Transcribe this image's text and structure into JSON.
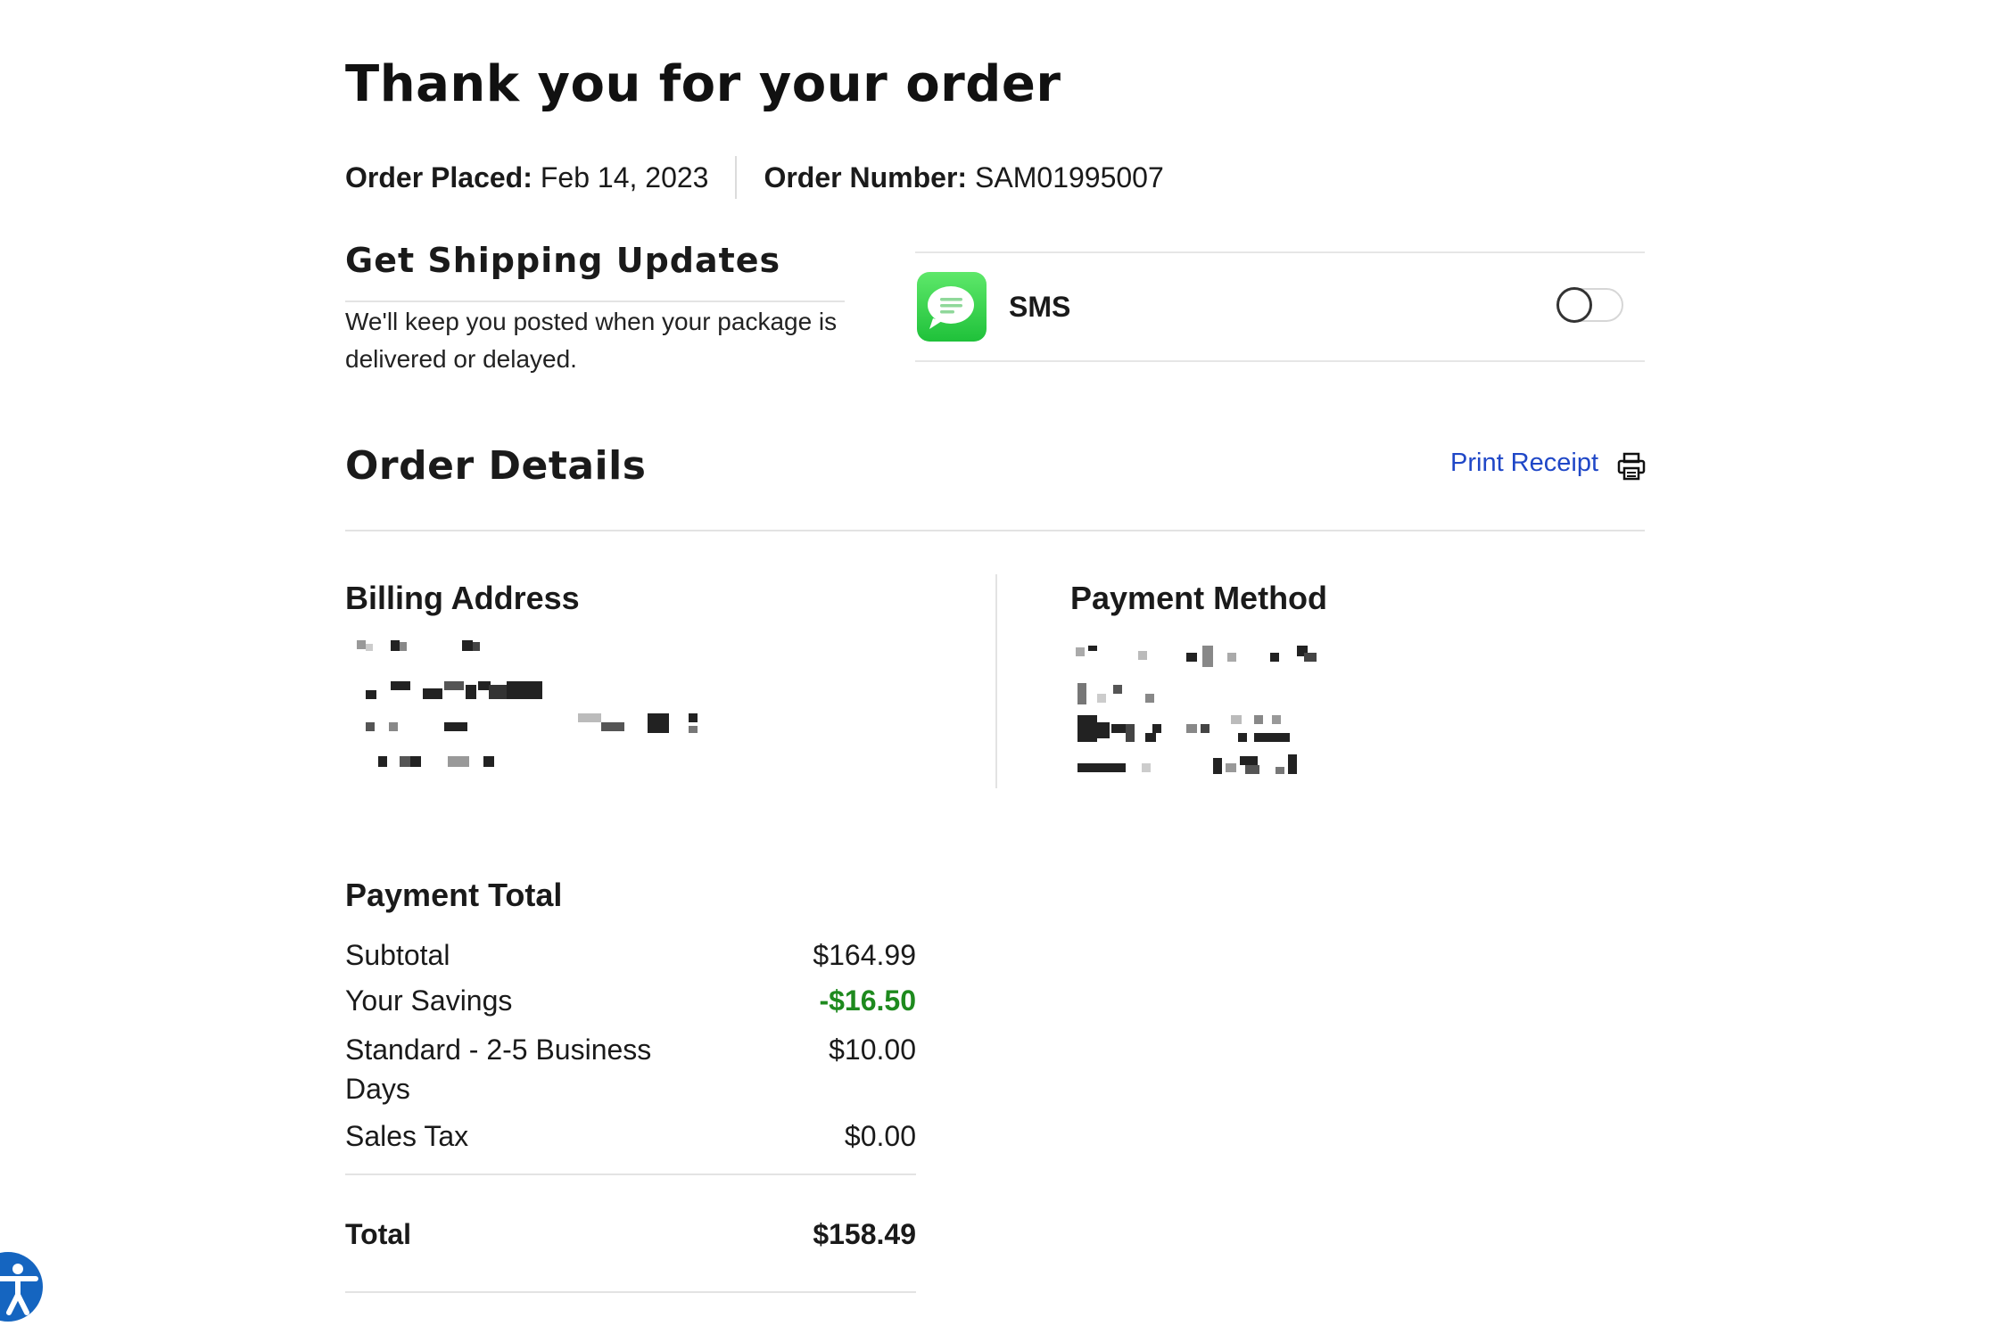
{
  "header": {
    "title": "Thank you for your order",
    "order_placed_label": "Order Placed:",
    "order_placed_value": "Feb 14, 2023",
    "order_number_label": "Order Number:",
    "order_number_value": "SAM01995007"
  },
  "shipping_updates": {
    "title": "Get Shipping Updates",
    "description": "We'll keep you posted when your package is delivered or delayed.",
    "channel_label": "SMS",
    "channel_icon": "message-bubble-icon",
    "toggle_on": false
  },
  "order_details": {
    "title": "Order Details",
    "print_label": "Print Receipt",
    "print_icon": "printer-icon",
    "billing_heading": "Billing Address",
    "payment_heading": "Payment Method"
  },
  "payment_total": {
    "heading": "Payment Total",
    "lines": [
      {
        "label": "Subtotal",
        "value": "$164.99"
      },
      {
        "label": "Your Savings",
        "value": "-$16.50"
      },
      {
        "label": "Standard - 2-5 Business Days",
        "value": "$10.00"
      },
      {
        "label": "Sales Tax",
        "value": "$0.00"
      }
    ],
    "total_label": "Total",
    "total_value": "$158.49"
  },
  "colors": {
    "link": "#1f47c7",
    "savings": "#1e8a1e",
    "sms_icon_green": "#28c840",
    "accessibility_blue": "#1565c0"
  },
  "accessibility": {
    "icon": "accessibility-icon"
  }
}
